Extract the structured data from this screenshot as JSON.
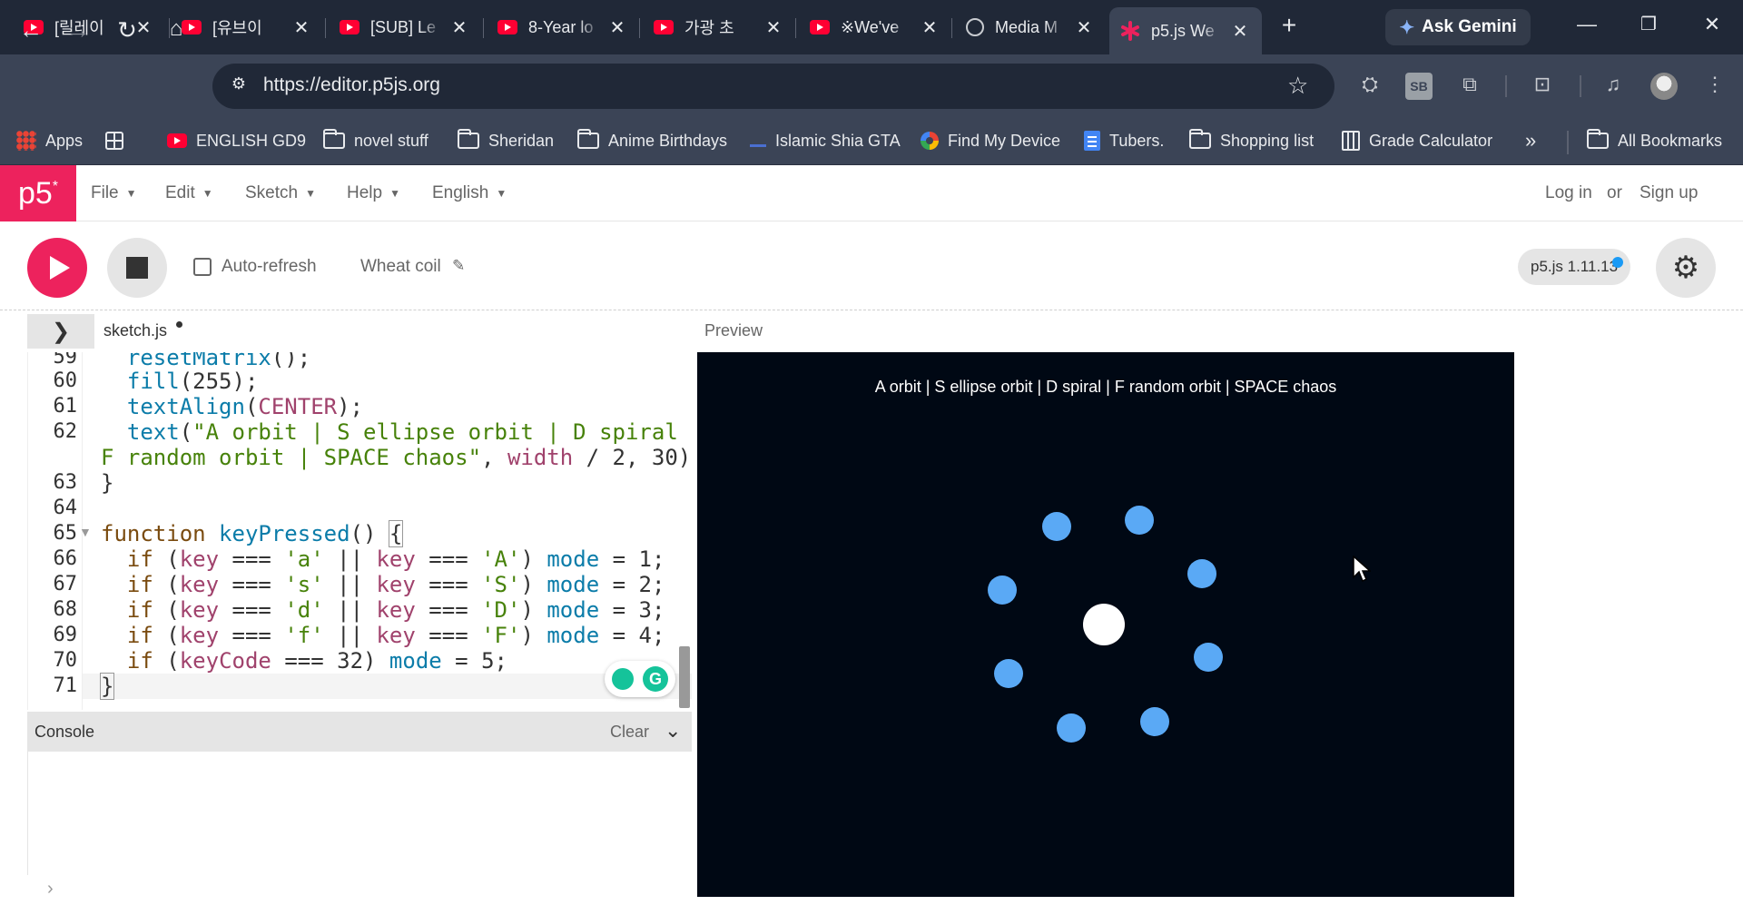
{
  "browser": {
    "tabs": [
      {
        "title": "[릴레이",
        "icon": "youtube-icon"
      },
      {
        "title": "[유브이",
        "icon": "youtube-icon"
      },
      {
        "title": "[SUB] Le",
        "icon": "youtube-icon"
      },
      {
        "title": "8-Year lo",
        "icon": "youtube-icon"
      },
      {
        "title": "가광 초",
        "icon": "youtube-icon"
      },
      {
        "title": "※We've",
        "icon": "youtube-icon"
      },
      {
        "title": "Media M",
        "icon": "globe-icon"
      },
      {
        "title": "p5.js We",
        "icon": "p5-icon",
        "active": true
      }
    ],
    "gemini_label": "Ask Gemini",
    "url": "https://editor.p5js.org",
    "bookmarks": [
      {
        "label": "Apps",
        "icon": "apps-grid-icon"
      },
      {
        "label": "",
        "icon": "tab-groups-icon"
      },
      {
        "label": "ENGLISH GD9",
        "icon": "youtube-icon"
      },
      {
        "label": "novel stuff",
        "icon": "folder-icon"
      },
      {
        "label": "Sheridan",
        "icon": "folder-icon"
      },
      {
        "label": "Anime Birthdays",
        "icon": "folder-icon"
      },
      {
        "label": "Islamic Shia GTA",
        "icon": "site-icon"
      },
      {
        "label": "Find My Device",
        "icon": "find-device-icon"
      },
      {
        "label": "Tubers.",
        "icon": "docs-icon"
      },
      {
        "label": "Shopping list",
        "icon": "folder-icon"
      },
      {
        "label": "Grade Calculator",
        "icon": "calculator-icon"
      },
      {
        "label": "All Bookmarks",
        "icon": "folder-icon"
      }
    ],
    "more_bookmarks": "»"
  },
  "p5": {
    "logo": "p5",
    "menus": [
      "File",
      "Edit",
      "Sketch",
      "Help",
      "English"
    ],
    "login": "Log in",
    "or": "or",
    "signup": "Sign up",
    "auto_refresh": "Auto-refresh",
    "sketch_name": "Wheat coil",
    "version": "p5.js 1.11.13",
    "file_name": "sketch.js",
    "preview_label": "Preview",
    "console_label": "Console",
    "clear_label": "Clear",
    "line_numbers": [
      "59",
      "60",
      "61",
      "62",
      "",
      "63",
      "64",
      "65",
      "66",
      "67",
      "68",
      "69",
      "70",
      "71"
    ]
  },
  "canvas": {
    "title": "A orbit | S ellipse orbit | D spiral | F random orbit | SPACE chaos",
    "background": "#000814",
    "center_color": "#ffffff",
    "orbiter_color": "#5aa9f5"
  },
  "colors": {
    "p5_pink": "#ed225d",
    "chrome_dark": "#202837",
    "chrome_mid": "#3b4456"
  }
}
